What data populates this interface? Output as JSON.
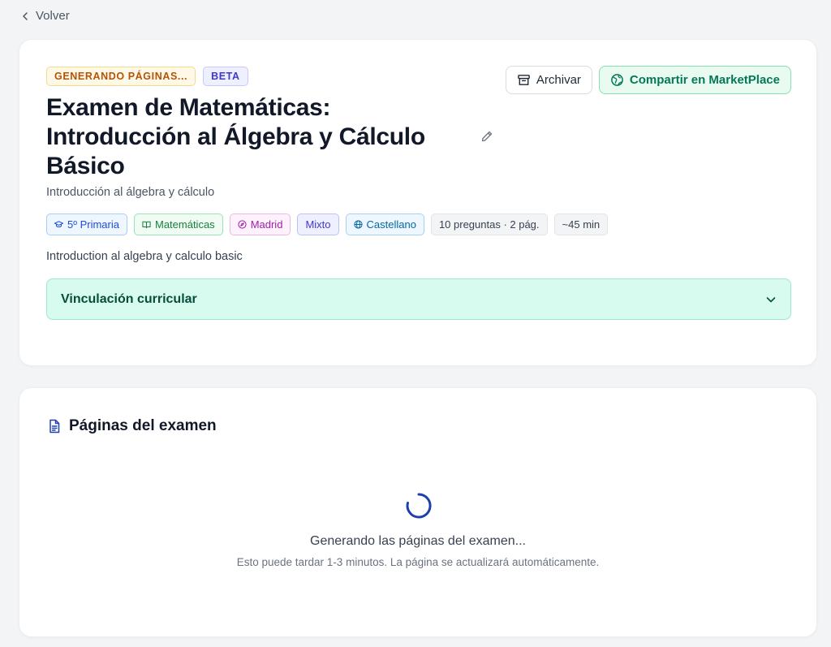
{
  "nav": {
    "back_label": "Volver"
  },
  "exam": {
    "status_badge": "GENERANDO PÁGINAS...",
    "beta_badge": "BETA",
    "title": "Examen de Matemáticas: Introducción al Álgebra y Cálculo Básico",
    "subtitle": "Introducción al álgebra y cálculo",
    "description": "Introduction al algebra y calculo basic",
    "tags": [
      {
        "label": "5º Primaria",
        "icon": "graduation-cap-icon",
        "color": "#1d4ed8"
      },
      {
        "label": "Matemáticas",
        "icon": "book-open-icon",
        "color": "#15803d"
      },
      {
        "label": "Madrid",
        "icon": "compass-icon",
        "color": "#a21caf"
      },
      {
        "label": "Mixto",
        "icon": "",
        "color": "#4338ca"
      },
      {
        "label": "Castellano",
        "icon": "globe-icon",
        "color": "#0369a1"
      },
      {
        "label": "10 preguntas · 2 pág.",
        "icon": "",
        "color": "#374151"
      },
      {
        "label": "~45 min",
        "icon": "",
        "color": "#374151"
      }
    ]
  },
  "actions": {
    "archive_label": "Archivar",
    "share_label": "Compartir en MarketPlace"
  },
  "curriculum": {
    "label": "Vinculación curricular"
  },
  "pages": {
    "title": "Páginas del examen",
    "loading_title": "Generando las páginas del examen...",
    "loading_subtitle": "Esto puede tardar 1-3 minutos. La página se actualizará automáticamente."
  },
  "colors": {
    "accent_green": "#047857",
    "warning": "#b45309",
    "spinner": "#1e40af"
  }
}
